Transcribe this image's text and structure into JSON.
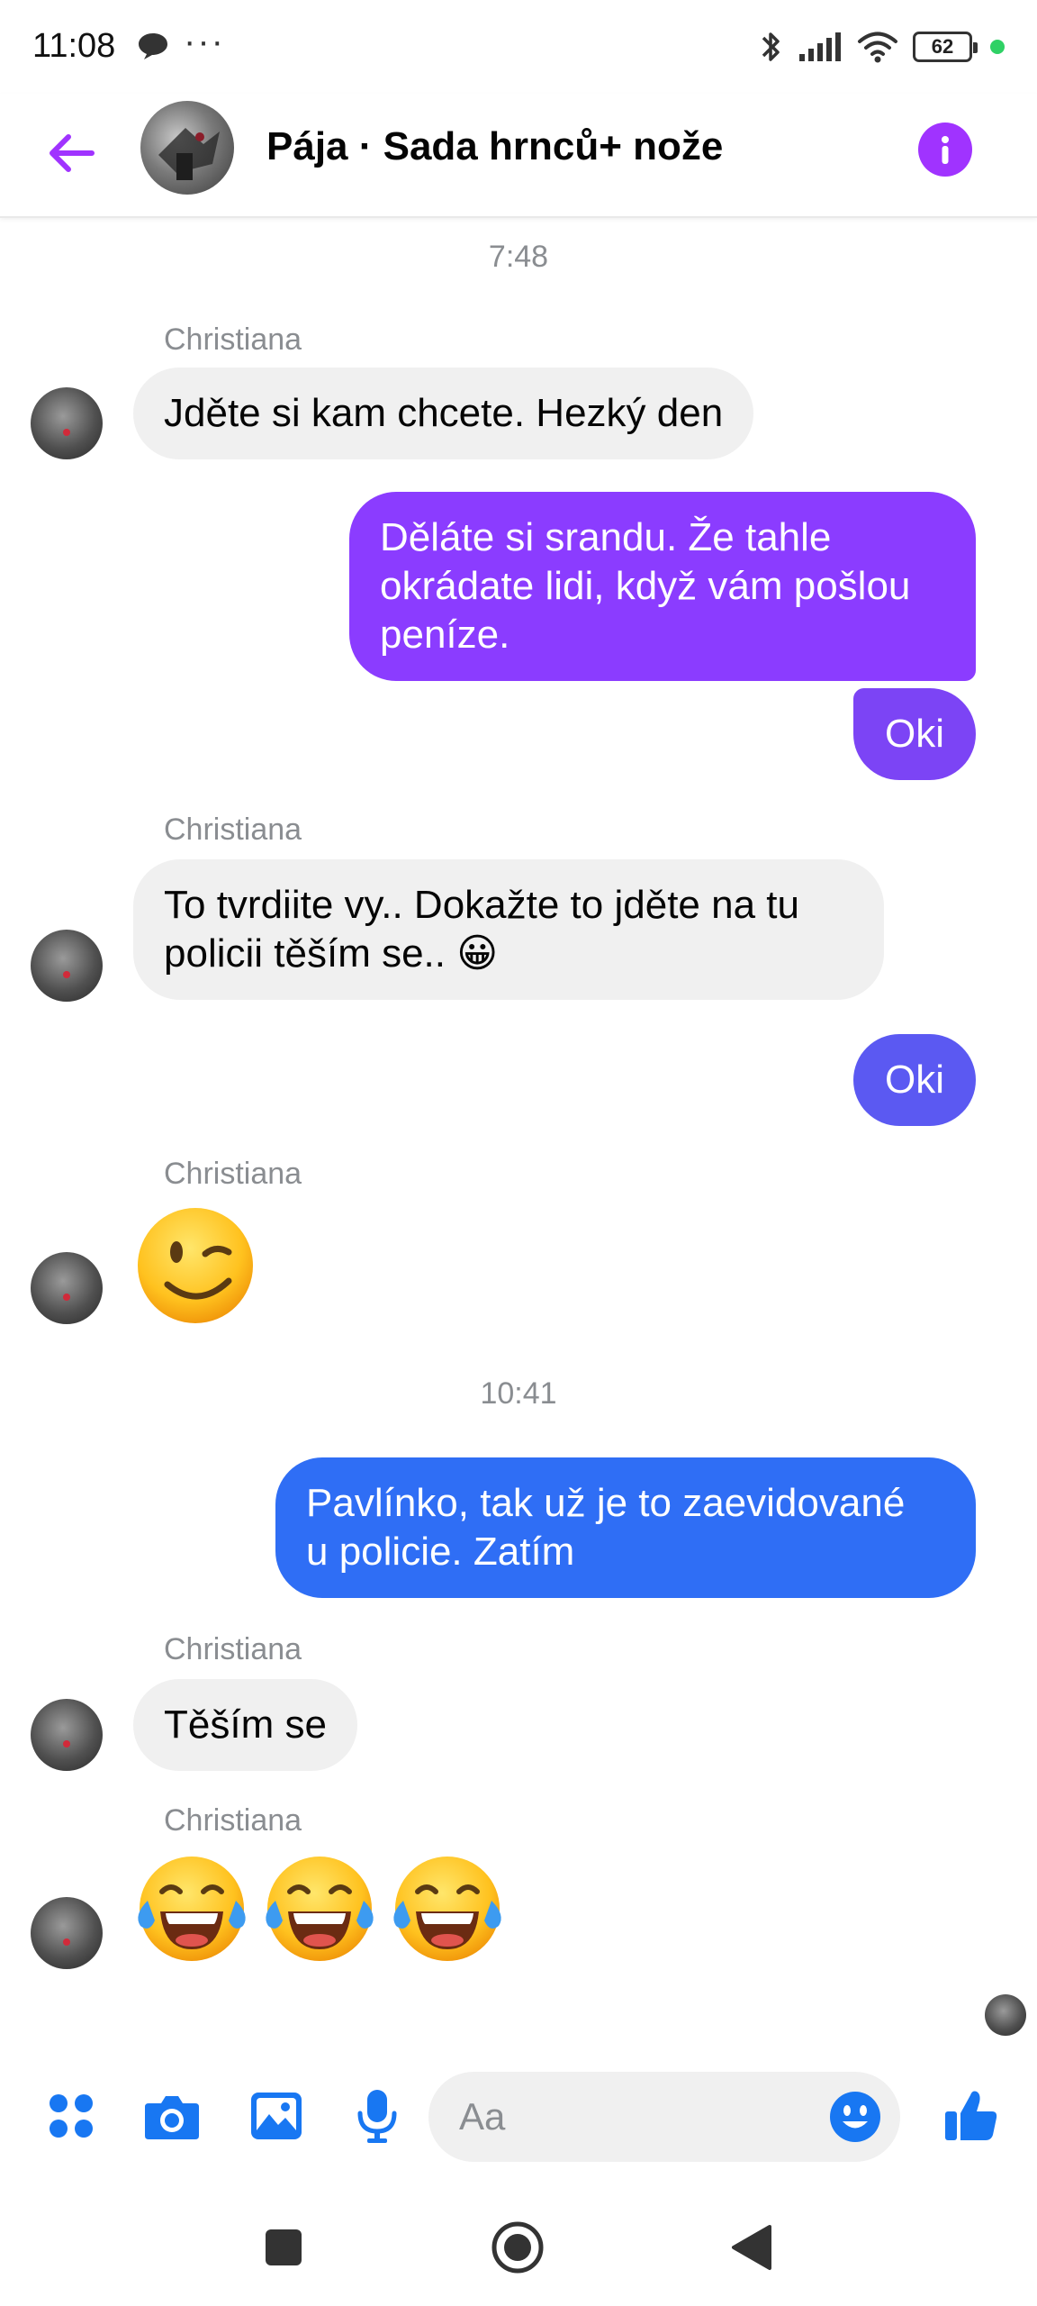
{
  "status_bar": {
    "time": "11:08",
    "dots": "···",
    "battery": "62"
  },
  "header": {
    "title": "Pája · Sada hrnců+ nože",
    "accent_color": "#a033ff"
  },
  "thread": {
    "timestamps": [
      "7:48",
      "10:41"
    ],
    "messages": [
      {
        "from": "Christiana",
        "text": "Jděte si kam chcete. Hezký den"
      },
      {
        "from": "me",
        "lines": [
          "Děláte si srandu. Že tahle",
          "okrádate lidi, když vám pošlou",
          "peníze."
        ],
        "color": "#8b3cff"
      },
      {
        "from": "me",
        "text": "Oki",
        "color": "#7c44f5"
      },
      {
        "from": "Christiana",
        "lines": [
          "To tvrdiite vy.. Dokažte to jděte na tu",
          "policii těším se.. 😀"
        ]
      },
      {
        "from": "me",
        "text": "Oki",
        "color": "#5b59f2"
      },
      {
        "from": "Christiana",
        "emoji": "😉"
      },
      {
        "from": "me",
        "lines": [
          "Pavlínko, tak už je to zaevidované",
          "u policie. Zatím"
        ],
        "color": "#2f6ef5"
      },
      {
        "from": "Christiana",
        "text": "Těším se"
      },
      {
        "from": "Christiana",
        "emoji": "😂😂😂"
      }
    ],
    "sender_name": "Christiana"
  },
  "composer": {
    "placeholder": "Aa",
    "icon_color": "#1877f2",
    "icons": [
      "menu-grid-icon",
      "camera-icon",
      "gallery-icon",
      "microphone-icon",
      "emoji-icon",
      "thumbs-up-icon"
    ]
  }
}
